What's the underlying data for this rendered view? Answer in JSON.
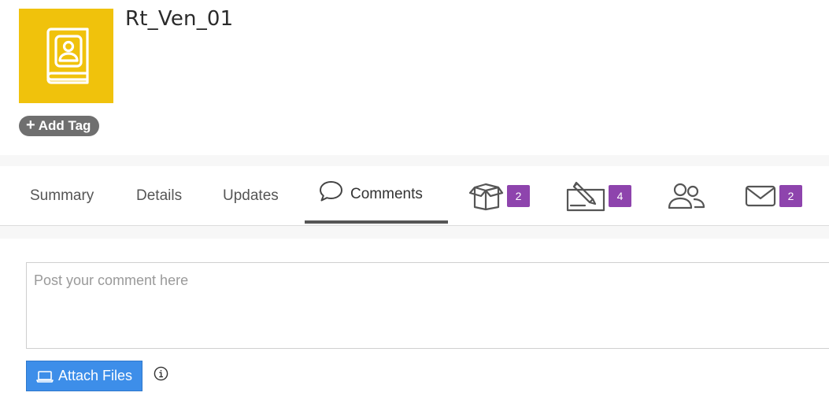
{
  "record": {
    "title": "Rt_Ven_01",
    "icon": "contact-book-icon",
    "avatar_color": "#f0c20c",
    "add_tag_label": "Add Tag"
  },
  "tabs": [
    {
      "label": "Summary"
    },
    {
      "label": "Details"
    },
    {
      "label": "Updates"
    },
    {
      "label": "Comments",
      "icon": "speech-bubble-icon",
      "active": true
    },
    {
      "icon": "box-icon",
      "count": "2"
    },
    {
      "icon": "signature-icon",
      "count": "4"
    },
    {
      "icon": "people-icon"
    },
    {
      "icon": "envelope-icon",
      "count": "2"
    }
  ],
  "badge_color": "#8e44ad",
  "comment": {
    "placeholder": "Post your comment here",
    "value": "",
    "attach_label": "Attach Files",
    "attach_color": "#3d8ee9",
    "info_icon": "info-icon"
  }
}
